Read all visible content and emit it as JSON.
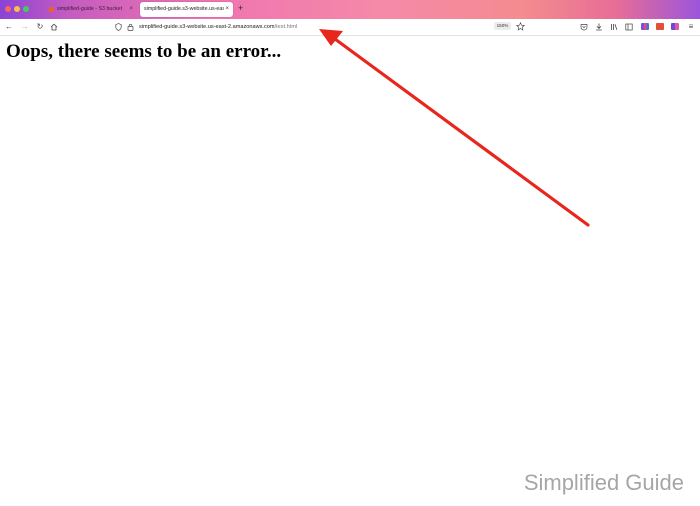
{
  "browser": {
    "tabs": [
      {
        "title": "simplified-guide - S3 bucket",
        "active": false
      },
      {
        "title": "simplified-guide.s3-website.us-east",
        "active": true
      }
    ],
    "address": {
      "host": "simplified-guide.s3-website.us-east-2.amazonaws.com",
      "path": "/test.html"
    },
    "zoom_level": "150%",
    "colors": {
      "titlebar_start": "#8a43d6",
      "titlebar_mid": "#f58aa8",
      "titlebar_end": "#9b55dc"
    }
  },
  "page": {
    "heading": "Oops, there seems to be an error..."
  },
  "annotation": {
    "arrow_color": "#e8261b"
  },
  "watermark": "Simplified Guide"
}
